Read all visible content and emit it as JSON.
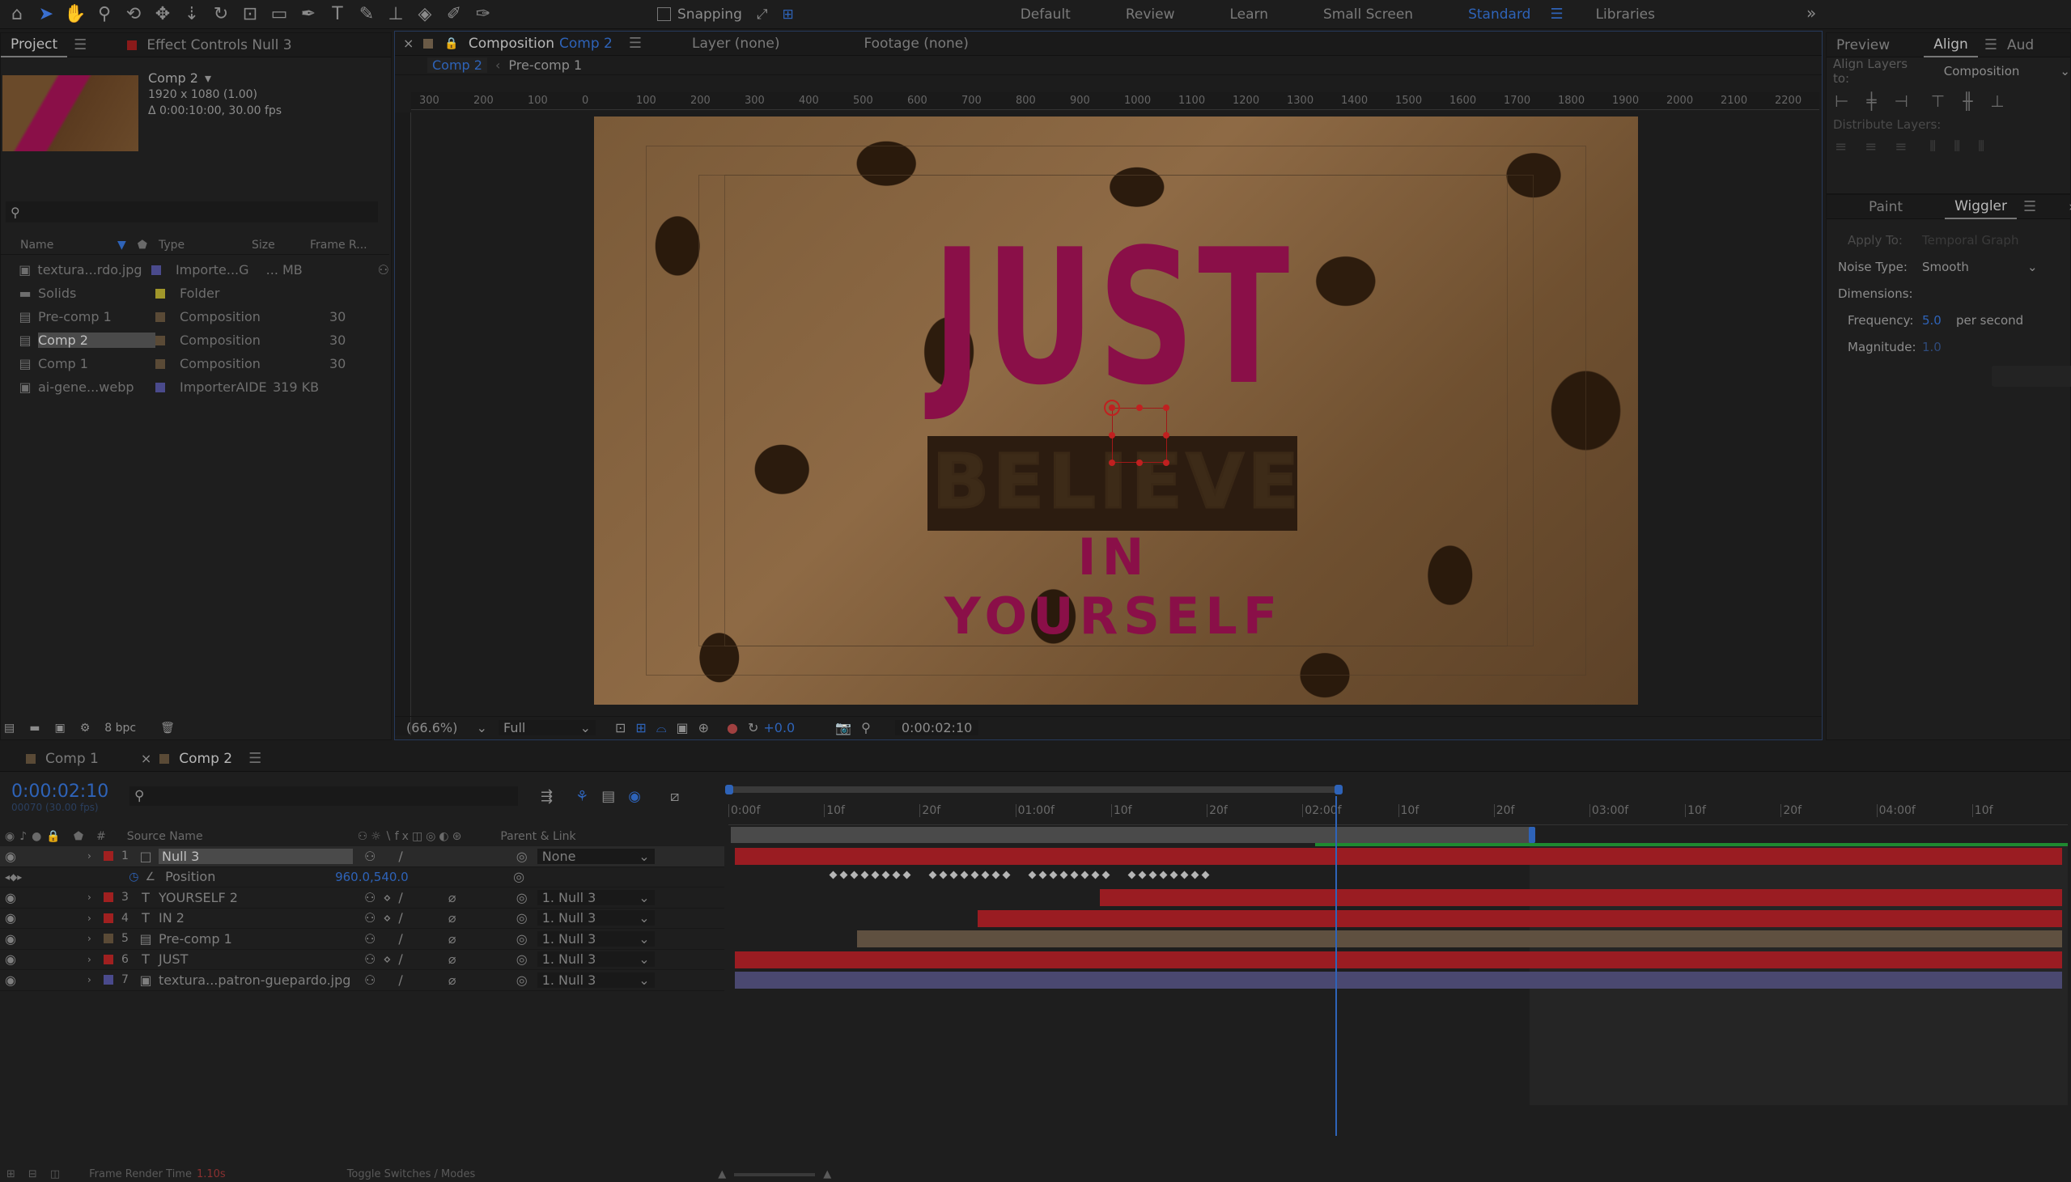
{
  "toolbar": {
    "snapping_label": "Snapping",
    "workspaces": [
      "Default",
      "Review",
      "Learn",
      "Small Screen",
      "Standard",
      "Libraries"
    ],
    "active_workspace": "Standard"
  },
  "project_panel": {
    "tab_project": "Project",
    "tab_effect_controls": "Effect Controls Null 3",
    "comp_name": "Comp 2",
    "comp_size": "1920 x 1080 (1.00)",
    "comp_duration": "Δ 0:00:10:00, 30.00 fps",
    "columns": [
      "Name",
      "Type",
      "Size",
      "Frame R..."
    ],
    "items": [
      {
        "name": "textura...rdo.jpg",
        "type": "Importe...G",
        "size": "... MB",
        "fps": "",
        "color": "#4a4a8c",
        "icon": "image-icon"
      },
      {
        "name": "Solids",
        "type": "Folder",
        "size": "",
        "fps": "",
        "color": "#a0962a",
        "icon": "folder-icon"
      },
      {
        "name": "Pre-comp 1",
        "type": "Composition",
        "size": "",
        "fps": "30",
        "color": "#5a4a36",
        "icon": "composition-icon"
      },
      {
        "name": "Comp 2",
        "type": "Composition",
        "size": "",
        "fps": "30",
        "color": "#5a4a36",
        "icon": "composition-icon",
        "selected": true
      },
      {
        "name": "Comp 1",
        "type": "Composition",
        "size": "",
        "fps": "30",
        "color": "#5a4a36",
        "icon": "composition-icon"
      },
      {
        "name": "ai-gene...webp",
        "type": "ImporterAIDE",
        "size": "319 KB",
        "fps": "",
        "color": "#4a4a8c",
        "icon": "image-icon"
      }
    ],
    "bpc": "8 bpc"
  },
  "viewer": {
    "tab_composition": "Composition",
    "tab_comp_name": "Comp 2",
    "tab_layer": "Layer (none)",
    "tab_footage": "Footage (none)",
    "breadcrumb_comp": "Comp 2",
    "breadcrumb_precomp": "Pre-comp 1",
    "ruler_labels": [
      "300",
      "200",
      "100",
      "0",
      "100",
      "200",
      "300",
      "400",
      "500",
      "600",
      "700",
      "800",
      "900",
      "1000",
      "1100",
      "1200",
      "1300",
      "1400",
      "1500",
      "1600",
      "1700",
      "1800",
      "1900",
      "2000",
      "2100",
      "2200"
    ],
    "text_just": "JUST",
    "text_believe": "BELIEVE",
    "text_in_yourself": "IN YOURSELF",
    "zoom": "(66.6%)",
    "resolution": "Full",
    "exposure": "+0.0",
    "timecode": "0:00:02:10"
  },
  "right_panel": {
    "tab_preview": "Preview",
    "tab_align": "Align",
    "tab_audio": "Aud",
    "align_layers_to_label": "Align Layers to:",
    "align_layers_to_value": "Composition",
    "distribute_label": "Distribute Layers:",
    "tab_paint": "Paint",
    "tab_wiggler": "Wiggler",
    "apply_to_label": "Apply To:",
    "apply_to_value": "Temporal Graph",
    "noise_type_label": "Noise Type:",
    "noise_type_value": "Smooth",
    "dimensions_label": "Dimensions:",
    "frequency_label": "Frequency:",
    "frequency_value": "5.0",
    "frequency_unit": "per second",
    "magnitude_label": "Magnitude:",
    "magnitude_value": "1.0"
  },
  "timeline": {
    "tab_comp1": "Comp 1",
    "tab_comp2": "Comp 2",
    "timecode": "0:00:02:10",
    "timecode_sub": "00070 (30.00 fps)",
    "col_source_name": "Source Name",
    "col_parent_link": "Parent & Link",
    "ruler_labels": [
      "0:00f",
      "10f",
      "20f",
      "01:00f",
      "10f",
      "20f",
      "02:00f",
      "10f",
      "20f",
      "03:00f",
      "10f",
      "20f",
      "04:00f",
      "10f"
    ],
    "playhead_fraction": 0.453,
    "layers": [
      {
        "num": "1",
        "name": "Null 3",
        "parent": "None",
        "color": "#a02020",
        "type": "null",
        "bar_start": 0.0,
        "bar_color": "#9a1c22",
        "selected": true
      },
      {
        "num": "3",
        "name": "YOURSELF 2",
        "parent": "1. Null 3",
        "color": "#a02020",
        "type": "T",
        "bar_start": 0.275,
        "bar_color": "#9a1c22"
      },
      {
        "num": "4",
        "name": "IN 2",
        "parent": "1. Null 3",
        "color": "#a02020",
        "type": "T",
        "bar_start": 0.183,
        "bar_color": "#9a1c22"
      },
      {
        "num": "5",
        "name": "Pre-comp 1",
        "parent": "1. Null 3",
        "color": "#5a4a36",
        "type": "comp",
        "bar_start": 0.092,
        "bar_color": "#5f5040"
      },
      {
        "num": "6",
        "name": "JUST",
        "parent": "1. Null 3",
        "color": "#a02020",
        "type": "T",
        "bar_start": 0.0,
        "bar_color": "#9a1c22"
      },
      {
        "num": "7",
        "name": "textura...patron-guepardo.jpg",
        "parent": "1. Null 3",
        "color": "#4a4a8c",
        "type": "image",
        "bar_start": 0.0,
        "bar_color": "#4a4870"
      }
    ],
    "position_label": "Position",
    "position_value": "960.0,540.0",
    "frame_render_label": "Frame Render Time",
    "frame_render_value": "1.10s",
    "toggle_label": "Toggle Switches / Modes"
  }
}
